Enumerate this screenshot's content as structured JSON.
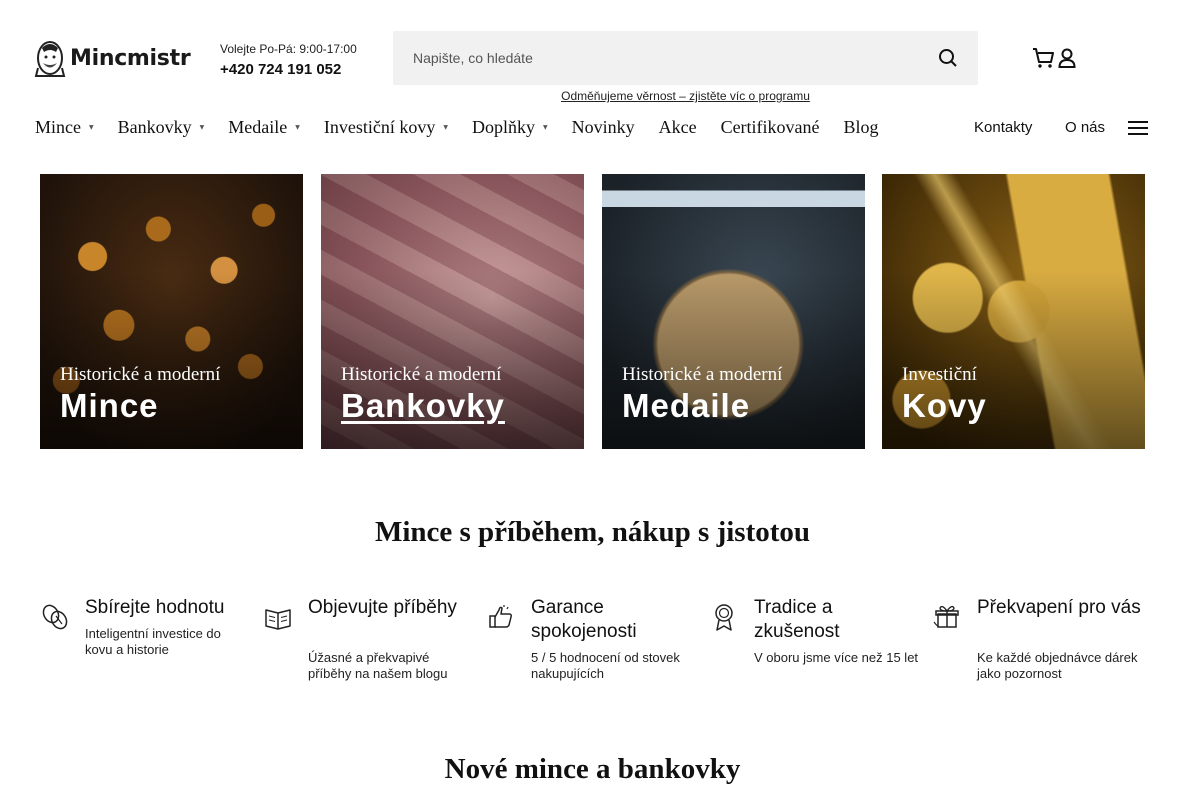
{
  "header": {
    "logo_text": "Mincmistr",
    "hours": "Volejte Po-Pá: 9:00-17:00",
    "phone": "+420 724 191 052",
    "search_placeholder": "Napište, co hledáte",
    "loyalty_link": "Odměňujeme věrnost – zjistěte víc o programu"
  },
  "nav": {
    "items": [
      {
        "label": "Mince",
        "dropdown": true
      },
      {
        "label": "Bankovky",
        "dropdown": true
      },
      {
        "label": "Medaile",
        "dropdown": true
      },
      {
        "label": "Investiční kovy",
        "dropdown": true
      },
      {
        "label": "Doplňky",
        "dropdown": true
      },
      {
        "label": "Novinky",
        "dropdown": false
      },
      {
        "label": "Akce",
        "dropdown": false
      },
      {
        "label": "Certifikované",
        "dropdown": false
      },
      {
        "label": "Blog",
        "dropdown": false
      }
    ],
    "caret": "▼",
    "contacts": "Kontakty",
    "about": "O nás"
  },
  "categories": [
    {
      "subtitle": "Historické a moderní",
      "title": "Mince"
    },
    {
      "subtitle": "Historické a moderní",
      "title": "Bankovky"
    },
    {
      "subtitle": "Historické a moderní",
      "title": "Medaile"
    },
    {
      "subtitle": "Investiční",
      "title": "Kovy"
    }
  ],
  "section_story": "Mince s příběhem, nákup s jistotou",
  "features": [
    {
      "icon": "coins-icon",
      "title": "Sbírejte hodnotu",
      "desc": "Inteligentní investice do kovu a historie"
    },
    {
      "icon": "book-icon",
      "title": "Objevujte příběhy",
      "desc": "Úžasné a překvapivé příběhy na našem blogu"
    },
    {
      "icon": "thumbs-up-icon",
      "title": "Garance spokojenosti",
      "desc": "5 / 5 hodnocení od stovek nakupujících"
    },
    {
      "icon": "award-icon",
      "title": "Tradice a zkušenost",
      "desc": "V oboru jsme více než 15 let"
    },
    {
      "icon": "gift-icon",
      "title": "Překvapení pro vás",
      "desc": "Ke každé objednávce dárek jako pozornost"
    }
  ],
  "section_new": "Nové mince a bankovky"
}
